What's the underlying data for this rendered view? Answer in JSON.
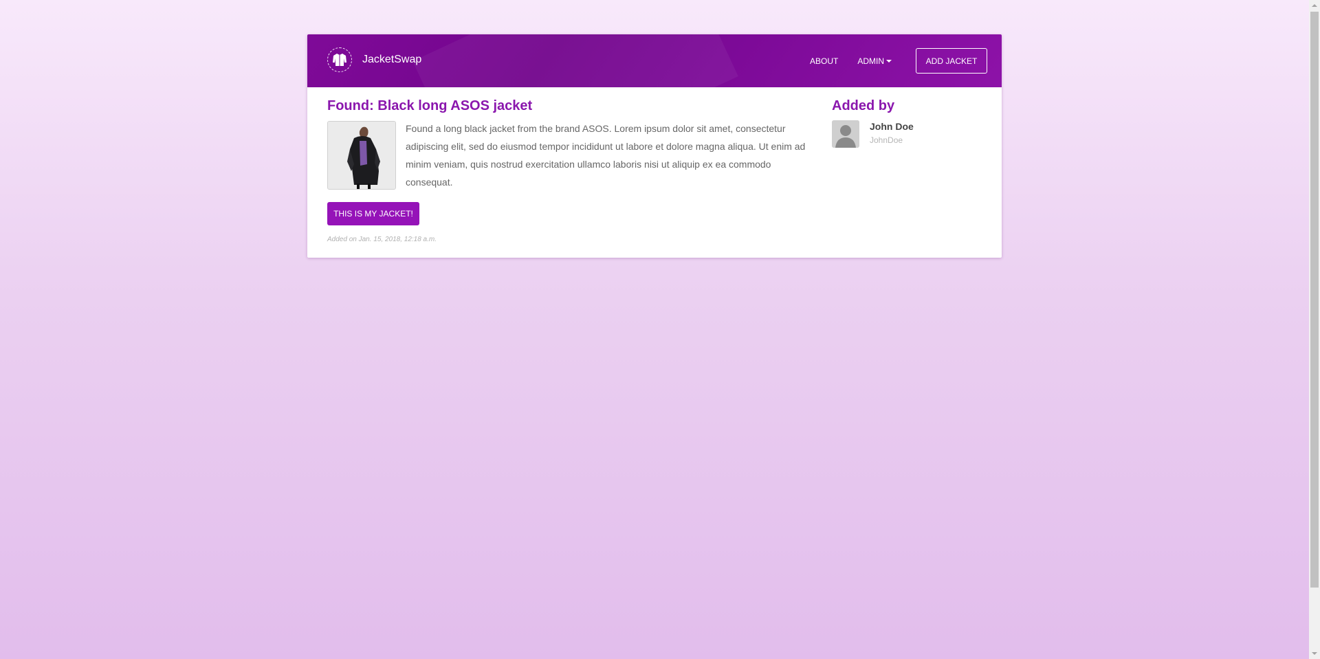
{
  "app": {
    "brand_name": "JacketSwap",
    "logo_icon": "jacket-icon"
  },
  "nav": {
    "about_label": "ABOUT",
    "admin_label": "ADMIN",
    "add_jacket_label": "ADD JACKET"
  },
  "item": {
    "title": "Found: Black long ASOS jacket",
    "description": "Found a long black jacket from the brand ASOS. Lorem ipsum dolor sit amet, consectetur adipiscing elit, sed do eiusmod tempor incididunt ut labore et dolore magna aliqua. Ut enim ad minim veniam, quis nostrud exercitation ullamco laboris nisi ut aliquip ex ea commodo consequat.",
    "claim_label": "THIS IS MY JACKET!",
    "added_on": "Added on Jan. 15, 2018, 12:18 a.m."
  },
  "sidebar": {
    "title": "Added by",
    "user_name": "John Doe",
    "user_handle": "JohnDoe"
  },
  "colors": {
    "primary": "#8a16ad",
    "navbar": "#7a0a94",
    "button": "#9513b8"
  }
}
